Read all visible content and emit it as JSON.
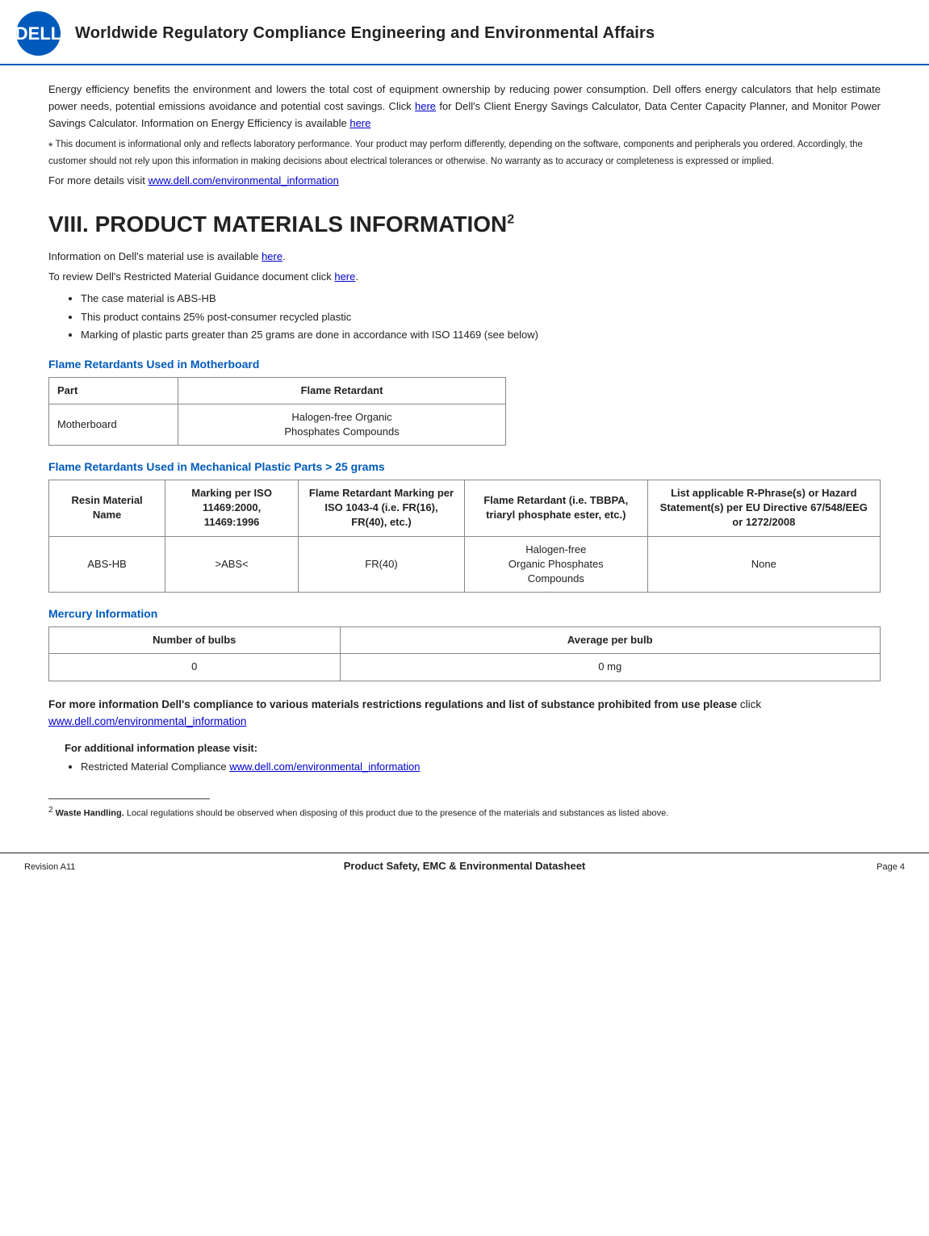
{
  "header": {
    "title": "Worldwide Regulatory Compliance Engineering and Environmental Affairs"
  },
  "intro": {
    "para1": "Energy efficiency benefits the environment and lowers the total cost of equipment ownership by reducing power consumption. Dell offers energy calculators that help estimate power needs, potential emissions avoidance and potential cost savings. Click ",
    "para1_link1_text": "here",
    "para1_mid": " for Dell's Client Energy Savings Calculator, Data Center Capacity Planner, and Monitor Power Savings Calculator. Information on Energy Efficiency is available ",
    "para1_link2_text": "here",
    "footnote_star": "*",
    "footnote_text": "  This document is informational only and reflects laboratory performance. Your product may perform differently, depending on the software, components and peripherals you ordered.  Accordingly, the customer should not rely upon this information in making decisions about electrical tolerances or otherwise.  No warranty as to accuracy or completeness is expressed or implied.",
    "visit_prefix": "For more details visit ",
    "visit_link": "www.dell.com/environmental_information"
  },
  "section8": {
    "heading": "VIII.  PRODUCT MATERIALS INFORMATION",
    "sup": "2",
    "info_line1_prefix": "Information on Dell's material use is available ",
    "info_line1_link": "here",
    "info_line1_suffix": ".",
    "info_line2_prefix": "To review Dell's Restricted Material Guidance document click ",
    "info_line2_link": "here",
    "info_line2_suffix": ".",
    "bullets": [
      "The case material is ABS-HB",
      "This product contains 25% post-consumer recycled plastic",
      "Marking of plastic parts greater than 25 grams are done in accordance with ISO 11469 (see below)"
    ]
  },
  "table_fr1": {
    "heading": "Flame Retardants Used in Motherboard",
    "col1": "Part",
    "col2": "Flame Retardant",
    "row1_col1": "Motherboard",
    "row1_col2": "Halogen-free Organic\nPhosphates Compounds"
  },
  "table_fr2": {
    "heading": "Flame Retardants Used in Mechanical Plastic Parts > 25 grams",
    "col1": "Resin Material Name",
    "col2": "Marking per ISO 11469:2000, 11469:1996",
    "col3": "Flame Retardant Marking per ISO 1043-4 (i.e. FR(16), FR(40), etc.)",
    "col4": "Flame Retardant (i.e. TBBPA, triaryl phosphate ester, etc.)",
    "col5": "List applicable R-Phrase(s) or Hazard Statement(s) per EU Directive 67/548/EEG or 1272/2008",
    "row1_col1": "ABS-HB",
    "row1_col2": ">ABS<",
    "row1_col3": "FR(40)",
    "row1_col4": "Halogen-free Organic Phosphates Compounds",
    "row1_col5": "None"
  },
  "table_mercury": {
    "heading": "Mercury Information",
    "col1": "Number of bulbs",
    "col2": "Average per bulb",
    "row1_col1": "0",
    "row1_col2": "0  mg"
  },
  "bold_section": {
    "text_bold": "For more information Dell's compliance to various materials restrictions regulations and list of substance prohibited from use please",
    "text_normal": " click ",
    "link": "www.dell.com/environmental_information"
  },
  "additional": {
    "heading": "For additional information please visit:",
    "bullet": "Restricted Material Compliance ",
    "bullet_link": "www.dell.com/environmental_information"
  },
  "footnote_bottom": {
    "sup": "2",
    "text": "  Waste Handling.",
    "text2": " Local regulations should be observed when disposing of this product due to the presence of the materials and substances as listed above."
  },
  "footer": {
    "center_text": "Product Safety, EMC & Environmental Datasheet",
    "revision": "Revision A11",
    "page": "Page 4"
  }
}
